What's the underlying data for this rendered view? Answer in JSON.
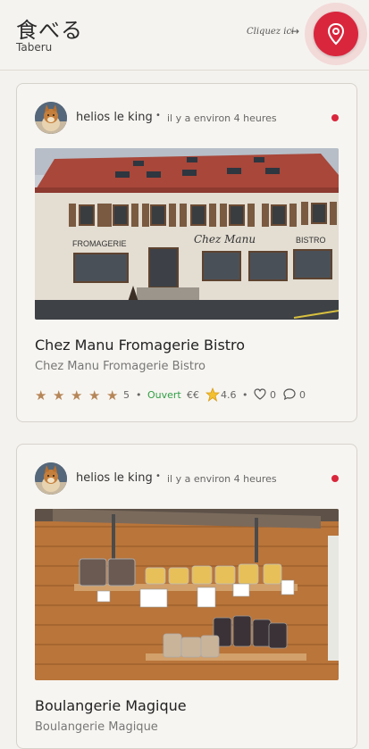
{
  "app": {
    "title": "食べる",
    "subtitle": "Taberu",
    "hint": "Cliquez ici",
    "hint_arrow": "→",
    "map_button_icon": "map-pin-icon",
    "accent_color": "#d9263d"
  },
  "posts": [
    {
      "author": "helios le king",
      "separator": "•",
      "time": "il y a environ 4 heures",
      "title": "Chez Manu Fromagerie Bistro",
      "subtitle": "Chez Manu Fromagerie Bistro",
      "photo_signs": {
        "left": "FROMAGERIE",
        "center": "Chez Manu",
        "right": "BISTRO"
      },
      "rating_stars": 5,
      "rating_value": "5",
      "status": "Ouvert",
      "price": "€€",
      "score_icon": "star-emoji-icon",
      "score": "4.6",
      "likes": "0",
      "comments": "0"
    },
    {
      "author": "helios le king",
      "separator": "•",
      "time": "il y a environ 4 heures",
      "title": "Boulangerie Magique",
      "subtitle": "Boulangerie Magique"
    }
  ]
}
